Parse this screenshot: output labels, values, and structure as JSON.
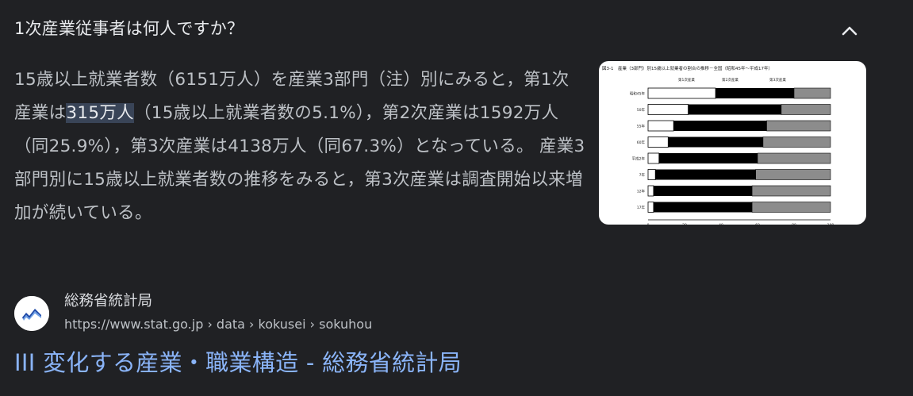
{
  "question": {
    "text": "1次産業従事者は何人ですか？"
  },
  "answer": {
    "before_highlight": "15歳以上就業者数（6151万人）を産業3部門（注）別にみると，第1次産業は",
    "highlight": "315万人",
    "after_highlight": "（15歳以上就業者数の5.1%），第2次産業は1592万人（同25.9%），第3次産業は4138万人（同67.3%）となっている。 産業3部門別に15歳以上就業者数の推移をみると，第3次産業は調査開始以来増加が続いている。"
  },
  "thumbnail": {
    "title": "図3-1　産業（3部門）別15歳以上就業者の割合の推移－全国（昭和45年～平成17年）",
    "legend": [
      "第1次産業",
      "第2次産業",
      "第3次産業"
    ],
    "rows": [
      "昭和45年",
      "50年",
      "55年",
      "60年",
      "平成2年",
      "7年",
      "12年",
      "17年"
    ],
    "axis_ticks": [
      "0",
      "20",
      "40",
      "60",
      "80",
      "100"
    ],
    "axis_unit": "(%)",
    "colors": {
      "primary": "#ffffff",
      "secondary": "#000000",
      "tertiary": "#8c8c8c"
    }
  },
  "source": {
    "site_name": "総務省統計局",
    "url": "https://www.stat.go.jp › data › kokusei › sokuhou",
    "favicon_icon": "stat-bureau-logo-icon"
  },
  "result": {
    "title": "III 変化する産業・職業構造 - 総務省統計局"
  },
  "icons": {
    "collapse": "chevron-up-icon"
  },
  "colors": {
    "background": "#202124",
    "text_primary": "#e8eaed",
    "text_secondary": "#bdc1c6",
    "link": "#8ab4f8",
    "highlight_bg": "#394457"
  }
}
